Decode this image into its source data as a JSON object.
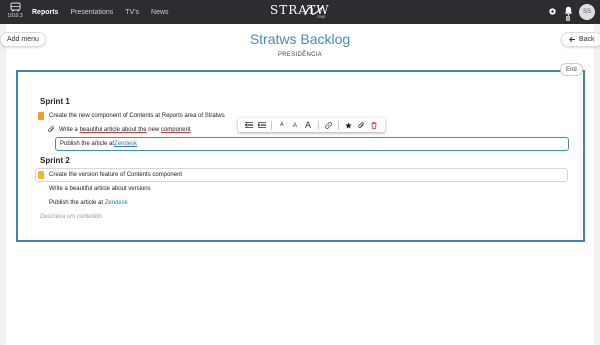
{
  "topbar": {
    "version": "1910.3",
    "nav": [
      {
        "label": "Reports",
        "active": true
      },
      {
        "label": "Presentations",
        "active": false
      },
      {
        "label": "TV's",
        "active": false
      },
      {
        "label": "News",
        "active": false
      }
    ],
    "brand": "STRATW",
    "brand_sub": "ONE",
    "avatar_initials": "SS",
    "notification_count": "0"
  },
  "header": {
    "add_menu_label": "Add menu",
    "back_label": "Back",
    "title": "Stratws Backlog",
    "subtitle": "PRESIDÊNCIA",
    "end_label": "End"
  },
  "sprints": [
    {
      "title": "Sprint 1",
      "task": "Create the new component of Contents at Reports area of Stratws",
      "sub1_pre": "Write a ",
      "sub1_link1": "beautiful article about the",
      "sub1_mid": " new ",
      "sub1_link2": "component",
      "edit_pre": "Publish the article at ",
      "edit_link": "Zendesk"
    },
    {
      "title": "Sprint 2",
      "task": "Create the version feature of Contents component",
      "sub1": "Write a beautiful article about versions",
      "sub2_pre": "Publish the article at ",
      "sub2_link": "Zendesk"
    }
  ],
  "placeholder": "Descreva um conteúdo",
  "toolbar": {
    "font_small": "A",
    "font_medium": "A",
    "font_large": "A"
  },
  "colors": {
    "accent": "#3d86ad",
    "topbar": "#2b2d30",
    "marker": "#f2a019",
    "link": "#2f7fb0",
    "delete": "#d9332f"
  }
}
